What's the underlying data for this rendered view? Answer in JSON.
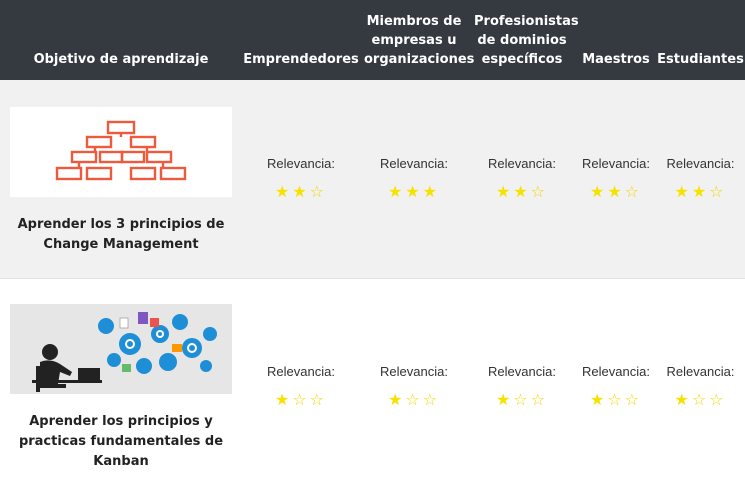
{
  "headers": [
    "Objetivo de aprendizaje",
    "Emprendedores",
    "Miembros de empresas u organizaciones",
    "Profesionistas de dominios específicos",
    "Maestros",
    "Estudiantes"
  ],
  "rows": [
    {
      "goal": "Aprender los 3 principios de Change Management",
      "image_icon": "org-chart-icon",
      "ratings": [
        {
          "label": "Relevancia:",
          "stars": 2,
          "max": 3
        },
        {
          "label": "Relevancia:",
          "stars": 3,
          "max": 3
        },
        {
          "label": "Relevancia:",
          "stars": 2,
          "max": 3
        },
        {
          "label": "Relevancia:",
          "stars": 2,
          "max": 3
        },
        {
          "label": "Relevancia:",
          "stars": 2,
          "max": 3
        }
      ]
    },
    {
      "goal": "Aprender los principios y practicas fundamentales de Kanban",
      "image_icon": "person-at-computer-with-gears-icon",
      "ratings": [
        {
          "label": "Relevancia:",
          "stars": 1,
          "max": 3
        },
        {
          "label": "Relevancia:",
          "stars": 1,
          "max": 3
        },
        {
          "label": "Relevancia:",
          "stars": 1,
          "max": 3
        },
        {
          "label": "Relevancia:",
          "stars": 1,
          "max": 3
        },
        {
          "label": "Relevancia:",
          "stars": 1,
          "max": 3
        }
      ]
    }
  ],
  "colors": {
    "header_bg": "#343a40",
    "row_alt_bg": "#f1f1f1",
    "star": "#f6e200",
    "org_chart": "#ef5a3c"
  }
}
